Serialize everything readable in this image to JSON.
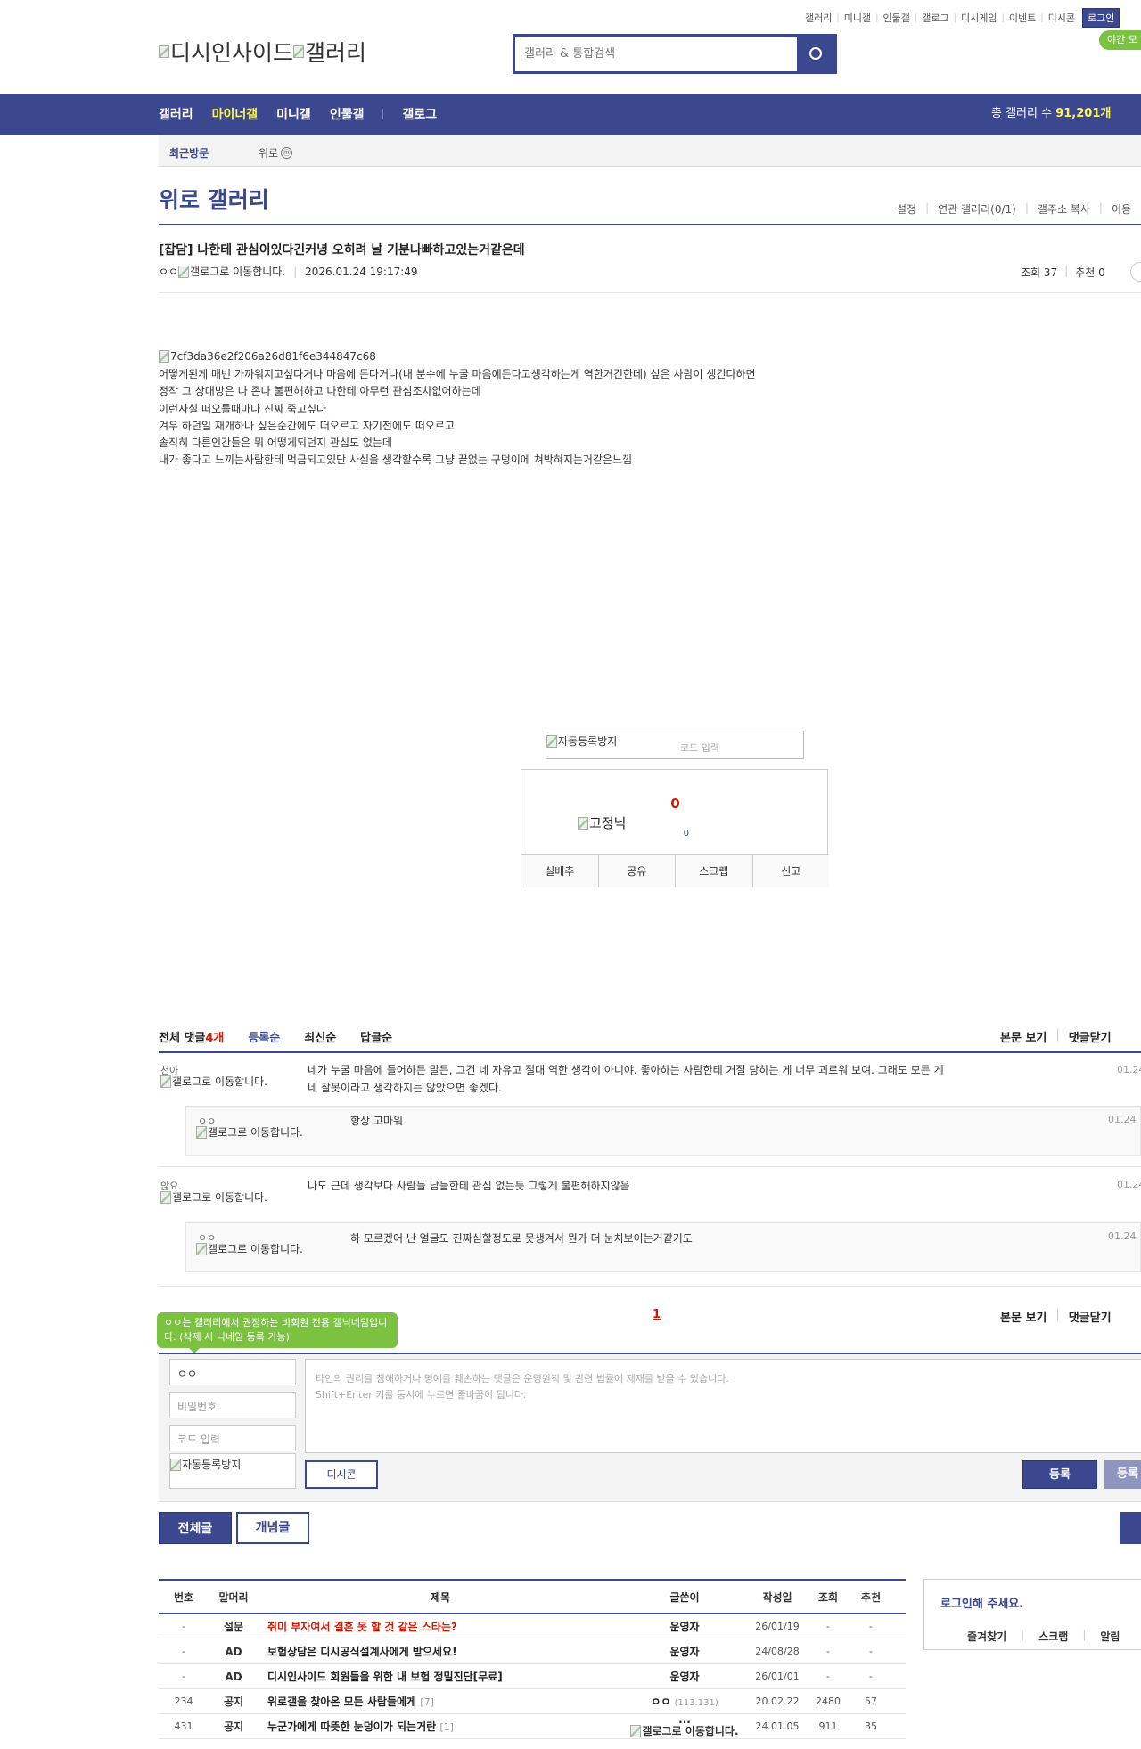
{
  "top_util": {
    "links": [
      "갤러리",
      "미니갤",
      "인물갤",
      "갤로그",
      "디시게임",
      "이벤트",
      "디시콘"
    ],
    "login": "로그인",
    "night_mode": "야간 모"
  },
  "logo": {
    "alt1": "디시인사이드",
    "alt2": "갤러리"
  },
  "search": {
    "placeholder": "갤러리 & 통합검색"
  },
  "nav": {
    "items": [
      "갤러리",
      "마이너갤",
      "미니갤",
      "인물갤",
      "갤로그"
    ],
    "total_label": "총 갤러리 수 ",
    "total_value": "91,201개"
  },
  "recent": {
    "label": "최근방문",
    "item": "위로",
    "badge": "ⓜ"
  },
  "gallery": {
    "title": "위로 갤러리",
    "links": [
      "설정",
      "연관 갤러리(0/1)",
      "갤주소 복사",
      "이용"
    ]
  },
  "post": {
    "title": "[잡담] 나한테 관심이있다긴커녕 오히려 날 기분나빠하고있는거같은데",
    "writer": "ㅇㅇ",
    "gallog_alt": "갤로그로 이동합니다.",
    "date": "2026.01.24 19:17:49",
    "views": "조회 37",
    "recommends": "추천 0",
    "image_alt": "7cf3da36e2f206a26d81f6e344847c68",
    "body": [
      "어떻게된게 매번 가까워지고싶다거나 마음에 든다거나(내 분수에 누굴 마음에든다고생각하는게 역한거긴한데) 싶은 사람이 생긴다하면",
      "정작 그 상대방은 나 존나 불편해하고 나한테 아무런 관심조차없어하는데",
      "이런사실 떠오를때마다 진짜 죽고싶다",
      "겨우 하던일 재개하나 싶은순간에도 떠오르고 자기전에도 떠오르고",
      "솔직히 다른인간들은 뭐 어떻게되던지 관심도 없는데",
      "내가 좋다고 느끼는사람한테 먹금되고있단 사실을 생각할수록 그냥 끝없는 구덩이에 쳐박혀지는거같은느낌"
    ]
  },
  "captcha": {
    "alt": "자동등록방지",
    "placeholder": "코드 입력"
  },
  "recommend": {
    "count": "0",
    "img_alt": "고정닉",
    "fixed_count": "0",
    "buttons": [
      "실베추",
      "공유",
      "스크랩",
      "신고"
    ]
  },
  "comments": {
    "total_label": "전체 댓글 ",
    "total_count": "4개",
    "sorts": [
      "등록순",
      "최신순",
      "답글순"
    ],
    "right_links": [
      "본문 보기",
      "댓글닫기"
    ],
    "items": [
      {
        "nick": "천아",
        "gallog": "갤로그로 이동합니다.",
        "text1": "네가 누굴 마음에 들어하든 말든, 그건 네 자유고 절대 역한 생각이 아니야. 좋아하는 사람한테 거절 당하는 게 너무 괴로워 보여. 그래도 모든 게",
        "text2": "네 잘못이라고 생각하지는 않았으면 좋겠다.",
        "date": "01.24"
      },
      {
        "nick": "ㅇㅇ",
        "gallog": "갤로그로 이동합니다.",
        "text": "항상 고마워",
        "date": "01.24"
      },
      {
        "nick": "않요.",
        "gallog": "갤로그로 이동합니다.",
        "text": "나도 근데 생각보다 사람들 남들한테 관심 없는듯 그렇게 불편해하지않음",
        "date": "01.24"
      },
      {
        "nick": "ㅇㅇ",
        "gallog": "갤로그로 이동합니다.",
        "text": "하 모르겠어 난 얼굴도 진짜심할정도로 못생겨서 뭔가 더 눈치보이는거같기도",
        "date": "01.24"
      }
    ],
    "page": "1"
  },
  "write": {
    "tooltip": "ㅇㅇ는 갤러리에서 권장하는 비회원 전용 갤닉네임입니다. (삭제 시 닉네임 등록 가능)",
    "nick_value": "ㅇㅇ",
    "password_placeholder": "비밀번호",
    "code_placeholder": "코드 입력",
    "captcha_alt": "자동등록방지",
    "textarea_line1": "타인의 권리를 침해하거나 명예를 훼손하는 댓글은 운영원칙 및 관련 법률에 제재를 받을 수 있습니다.",
    "textarea_line2": "Shift+Enter 키를 동시에 누르면 줄바꿈이 됩니다.",
    "dccon": "디시콘",
    "register": "등록",
    "register2": "등록"
  },
  "tabs": {
    "all": "전체글",
    "concept": "개념글"
  },
  "list": {
    "headers": [
      "번호",
      "말머리",
      "제목",
      "글쓴이",
      "작성일",
      "조회",
      "추천"
    ],
    "rows": [
      {
        "no": "-",
        "head": "설문",
        "title": "취미 부자여서 결혼 못 할 것 같은 스타는?",
        "reply": "",
        "writer": "운영자",
        "ip": "",
        "date": "26/01/19",
        "views": "-",
        "rec": "-",
        "title_color": "#d31900"
      },
      {
        "no": "-",
        "head": "AD",
        "title": "보험상담은 디시공식설계사에게 받으세요!",
        "reply": "",
        "writer": "운영자",
        "ip": "",
        "date": "24/08/28",
        "views": "-",
        "rec": "-",
        "title_color": "#222222"
      },
      {
        "no": "-",
        "head": "AD",
        "title": "디시인사이드 회원들을 위한 내 보험 정밀진단[무료]",
        "reply": "",
        "writer": "운영자",
        "ip": "",
        "date": "26/01/01",
        "views": "-",
        "rec": "-",
        "title_color": "#222222"
      },
      {
        "no": "234",
        "head": "공지",
        "title": "위로갤을 찾아온 모든 사람들에게",
        "reply": "[7]",
        "writer": "ㅇㅇ",
        "ip": "(113.131)",
        "date": "20.02.22",
        "views": "2480",
        "rec": "57",
        "title_color": "#222222"
      },
      {
        "no": "431",
        "head": "공지",
        "title": "누군가에게 따뜻한 눈덩이가 되는거란",
        "reply": "[1]",
        "writer": "...",
        "ip": "",
        "date": "24.01.05",
        "views": "911",
        "rec": "35",
        "title_color": "#222222"
      }
    ],
    "last_row_gallog": "갤로그로 이동합니다."
  },
  "login_box": {
    "title": "로그인해 주세요.",
    "links": [
      "즐겨찾기",
      "스크랩",
      "알림"
    ]
  }
}
